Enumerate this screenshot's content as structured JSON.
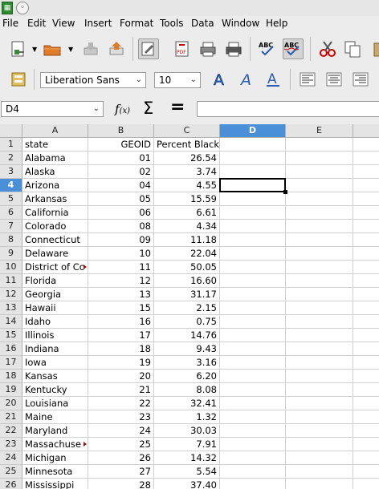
{
  "menu": [
    "File",
    "Edit",
    "View",
    "Insert",
    "Format",
    "Tools",
    "Data",
    "Window",
    "Help"
  ],
  "font": {
    "name": "Liberation Sans",
    "size": "10"
  },
  "name_box": "D4",
  "formula": "",
  "columns": [
    "A",
    "B",
    "C",
    "D",
    "E"
  ],
  "selected_column": "D",
  "selected_row": "4",
  "rows": [
    {
      "num": "1",
      "state": "state",
      "geoid": "GEOID",
      "pct": "Percent Black"
    },
    {
      "num": "2",
      "state": "Alabama",
      "geoid": "01",
      "pct": "26.54"
    },
    {
      "num": "3",
      "state": "Alaska",
      "geoid": "02",
      "pct": "3.74"
    },
    {
      "num": "4",
      "state": "Arizona",
      "geoid": "04",
      "pct": "4.55"
    },
    {
      "num": "5",
      "state": "Arkansas",
      "geoid": "05",
      "pct": "15.59"
    },
    {
      "num": "6",
      "state": "California",
      "geoid": "06",
      "pct": "6.61"
    },
    {
      "num": "7",
      "state": "Colorado",
      "geoid": "08",
      "pct": "4.34"
    },
    {
      "num": "8",
      "state": "Connecticut",
      "geoid": "09",
      "pct": "11.18"
    },
    {
      "num": "9",
      "state": "Delaware",
      "geoid": "10",
      "pct": "22.04"
    },
    {
      "num": "10",
      "state": "District of Co",
      "geoid": "11",
      "pct": "50.05",
      "overflow": true
    },
    {
      "num": "11",
      "state": "Florida",
      "geoid": "12",
      "pct": "16.60"
    },
    {
      "num": "12",
      "state": "Georgia",
      "geoid": "13",
      "pct": "31.17"
    },
    {
      "num": "13",
      "state": "Hawaii",
      "geoid": "15",
      "pct": "2.15"
    },
    {
      "num": "14",
      "state": "Idaho",
      "geoid": "16",
      "pct": "0.75"
    },
    {
      "num": "15",
      "state": "Illinois",
      "geoid": "17",
      "pct": "14.76"
    },
    {
      "num": "16",
      "state": "Indiana",
      "geoid": "18",
      "pct": "9.43"
    },
    {
      "num": "17",
      "state": "Iowa",
      "geoid": "19",
      "pct": "3.16"
    },
    {
      "num": "18",
      "state": "Kansas",
      "geoid": "20",
      "pct": "6.20"
    },
    {
      "num": "19",
      "state": "Kentucky",
      "geoid": "21",
      "pct": "8.08"
    },
    {
      "num": "20",
      "state": "Louisiana",
      "geoid": "22",
      "pct": "32.41"
    },
    {
      "num": "21",
      "state": "Maine",
      "geoid": "23",
      "pct": "1.32"
    },
    {
      "num": "22",
      "state": "Maryland",
      "geoid": "24",
      "pct": "30.03"
    },
    {
      "num": "23",
      "state": "Massachuse",
      "geoid": "25",
      "pct": "7.91",
      "overflow": true
    },
    {
      "num": "24",
      "state": "Michigan",
      "geoid": "26",
      "pct": "14.32"
    },
    {
      "num": "25",
      "state": "Minnesota",
      "geoid": "27",
      "pct": "5.54"
    },
    {
      "num": "26",
      "state": "Mississippi",
      "geoid": "28",
      "pct": "37.40"
    }
  ]
}
